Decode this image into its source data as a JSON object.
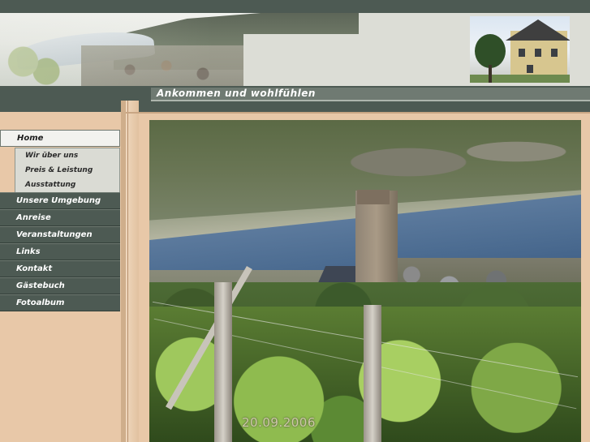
{
  "header": {
    "tagline": "Ankommen und wohlfühlen"
  },
  "nav": {
    "items": [
      {
        "label": "Home",
        "active": true
      },
      {
        "label": "Unsere Umgebung"
      },
      {
        "label": "Anreise"
      },
      {
        "label": "Veranstaltungen"
      },
      {
        "label": "Links"
      },
      {
        "label": "Kontakt"
      },
      {
        "label": "Gästebuch"
      },
      {
        "label": "Fotoalbum"
      }
    ],
    "subitems": [
      {
        "label": "Wir über uns"
      },
      {
        "label": "Preis & Leistung"
      },
      {
        "label": "Ausstattung"
      }
    ]
  },
  "main": {
    "photo_date": "20.09.2006"
  },
  "colors": {
    "nav_dark": "#4d5a53",
    "page_bg": "#e8c8a8",
    "header_light": "#dcddd6"
  }
}
